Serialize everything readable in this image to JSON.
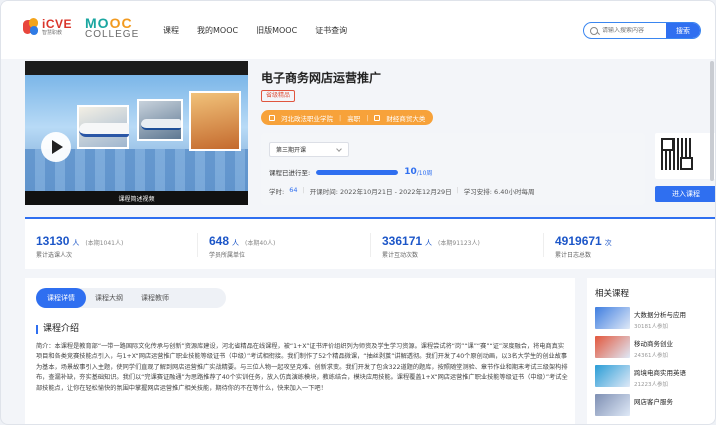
{
  "header": {
    "logo_icve_text": "iCVE",
    "logo_icve_sub": "智慧职教",
    "logo_mooc_prefix": "MO",
    "logo_mooc_suffix": "OC",
    "logo_college": "COLLEGE",
    "nav": [
      "课程",
      "我的MOOC",
      "旧版MOOC",
      "证书查询"
    ],
    "search_placeholder": "请输入搜索内容",
    "search_button": "搜索"
  },
  "course": {
    "title": "电子商务网店运营推广",
    "video_caption": "课程简述视频",
    "tag": "省级精品",
    "school": "河北政法职业学院",
    "level": "高职",
    "category": "财经商贸大类",
    "term": "第三期开课",
    "progress_label": "课程已进行至:",
    "progress_current": "10",
    "progress_total": "/10周",
    "progress_fraction": 1.0,
    "hours_label": "学时:",
    "hours_value": "64",
    "open_time": "开课时间: 2022年10月21日 - 2022年12月29日",
    "schedule": "学习安排: 6.40小时每周",
    "enter_button": "进入课程"
  },
  "stats": [
    {
      "num": "13130",
      "unit": "人",
      "sub": "(本期1041人)",
      "label": "累计选课人次"
    },
    {
      "num": "648",
      "unit": "人",
      "sub": "(本期40人)",
      "label": "学员所属单位"
    },
    {
      "num": "336171",
      "unit": "人",
      "sub": "(本期91123人)",
      "label": "累计互动次数"
    },
    {
      "num": "4919671",
      "unit": "次",
      "sub": "",
      "label": "累计日志总数"
    }
  ],
  "tabs": [
    "课程详情",
    "课程大纲",
    "课程教师"
  ],
  "intro": {
    "title": "课程介绍",
    "text": "简介：本课程是教育部“一带一路国际文化传承与创新”资源库建设，河北省精品在线课程，被“1+X”证书评价组织列为师资及学生学习资源。课程尝试将“岗”“课”“赛”“证”深度融合，将电商真实项目和各类竞赛技能点引入，与1+X“网店运营推广职业技能等级证书（中级）”考试相衔接。我们制作了52个精品微课，“抽丝剥茧”讲解透彻。我们开发了40个原创动画，以3名大学生的创业故事为基本，场景故事引入主题，使同学们直观了解到网店运营推广实战精要。与三位人物一起攻坚克难、创新求变。我们开发了包含322道题的题库，按照随堂测验、章节作业和期末考试三级架构排布，查漏补缺，夯实基础知识。我们以“完课赛证融通”为思路推荐了40个实训任务，放入仿真演练模块，教练结合，模块应用技能。课程覆盖1+X“网店运营推广职业技能等级证书（中级）”考试全部技能点，让你在轻松愉快的氛围中掌握网店运营推广相关技能，期待你的不在等什么，快来加入一下吧！"
  },
  "related": {
    "title": "相关课程",
    "items": [
      {
        "name": "大数据分析与应用",
        "count": "30181人参加",
        "color": "#3f7ee0"
      },
      {
        "name": "移动商务创业",
        "count": "24361人参加",
        "color": "#e2573d"
      },
      {
        "name": "跨境电商实用英语",
        "count": "21223人参加",
        "color": "#2a9dd6"
      },
      {
        "name": "网店客户服务",
        "count": "",
        "color": "#7e8fb3"
      }
    ]
  },
  "colors": {
    "accent": "#2f6ff0",
    "orange": "#f7a23a",
    "tag_red": "#e0553f"
  }
}
